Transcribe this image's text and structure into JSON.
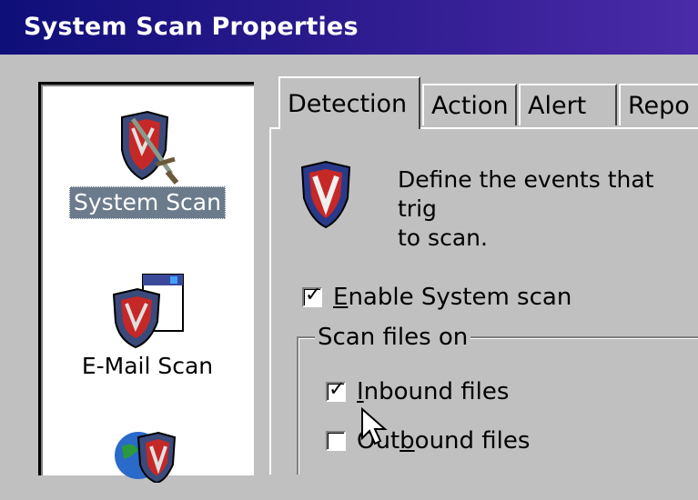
{
  "window": {
    "title": "System Scan Properties"
  },
  "sidebar": {
    "items": [
      {
        "label": "System Scan",
        "icon": "sword-shield-icon",
        "selected": true
      },
      {
        "label": "E-Mail Scan",
        "icon": "email-shield-icon",
        "selected": false
      },
      {
        "label": "",
        "icon": "globe-shield-icon",
        "selected": false
      }
    ]
  },
  "tabs": [
    {
      "label": "Detection",
      "active": true
    },
    {
      "label": "Action",
      "active": false
    },
    {
      "label": "Alert",
      "active": false
    },
    {
      "label": "Repo",
      "active": false
    }
  ],
  "detection": {
    "description_line1": "Define the events that trig",
    "description_line2": "to scan.",
    "enable_label_first": "E",
    "enable_label_rest": "nable System scan",
    "enable_checked": true,
    "group_label": "Scan files on",
    "inbound_first": "I",
    "inbound_rest": "nbound files",
    "inbound_checked": true,
    "outbound_first": "O",
    "outbound_rest": "ut",
    "outbound_u": "b",
    "outbound_end": "ound files",
    "outbound_checked": false
  },
  "colors": {
    "title_start": "#0f0f7a",
    "title_end": "#4a2aa8",
    "selection": "#6b7b8c"
  }
}
